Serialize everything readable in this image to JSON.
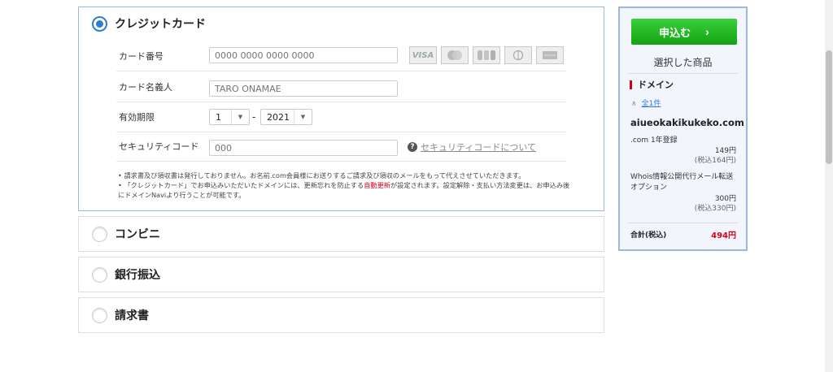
{
  "payment": {
    "credit": {
      "title": "クレジットカード",
      "fields": {
        "number": {
          "label": "カード番号",
          "placeholder": "0000 0000 0000 0000"
        },
        "holder": {
          "label": "カード名義人",
          "placeholder": "TARO ONAMAE"
        },
        "expiry": {
          "label": "有効期限",
          "month": "1",
          "separator": "-",
          "year": "2021"
        },
        "security": {
          "label": "セキュリティコード",
          "placeholder": "000",
          "help_link": "セキュリティコードについて",
          "help_glyph": "?"
        }
      },
      "card_brands": [
        "VISA",
        "MasterCard",
        "JCB",
        "Diners Club",
        "AMEX"
      ],
      "notes": {
        "line1": "請求書及び領収書は発行しておりません。お名前.com会員様にお送りするご請求及び領収のメールをもって代えさせていただきます。",
        "line2_before": "「クレジットカード」でお申込みいただいたドメインには、更新忘れを防止する",
        "line2_red": "自動更新",
        "line2_after": "が設定されます。設定解除・支払い方法変更は、お申込み後にドメインNaviより行うことが可能です。"
      }
    },
    "convenience": {
      "title": "コンビニ"
    },
    "bank": {
      "title": "銀行振込"
    },
    "invoice": {
      "title": "請求書"
    }
  },
  "summary": {
    "apply_label": "申込む",
    "apply_chevron": "›",
    "heading": "選択した商品",
    "section_title": "ドメイン",
    "toggle_caret": "∧",
    "toggle_label": "全1件",
    "domain_name": "aiueokakikukeko.com",
    "items": [
      {
        "name": ".com 1年登録",
        "price": "149円",
        "tax_price": "(税込164円)"
      },
      {
        "name": "Whois情報公開代行メール転送オプション",
        "price": "300円",
        "tax_price": "(税込330円)"
      }
    ],
    "total_label": "合計(税込)",
    "total_value": "494円"
  },
  "colors": {
    "accent_blue": "#2e7bd6",
    "panel_border": "#9bb8de",
    "cta_green": "#1fb51f",
    "alert_red": "#d0021b",
    "summary_bg": "#f2f6fc"
  }
}
